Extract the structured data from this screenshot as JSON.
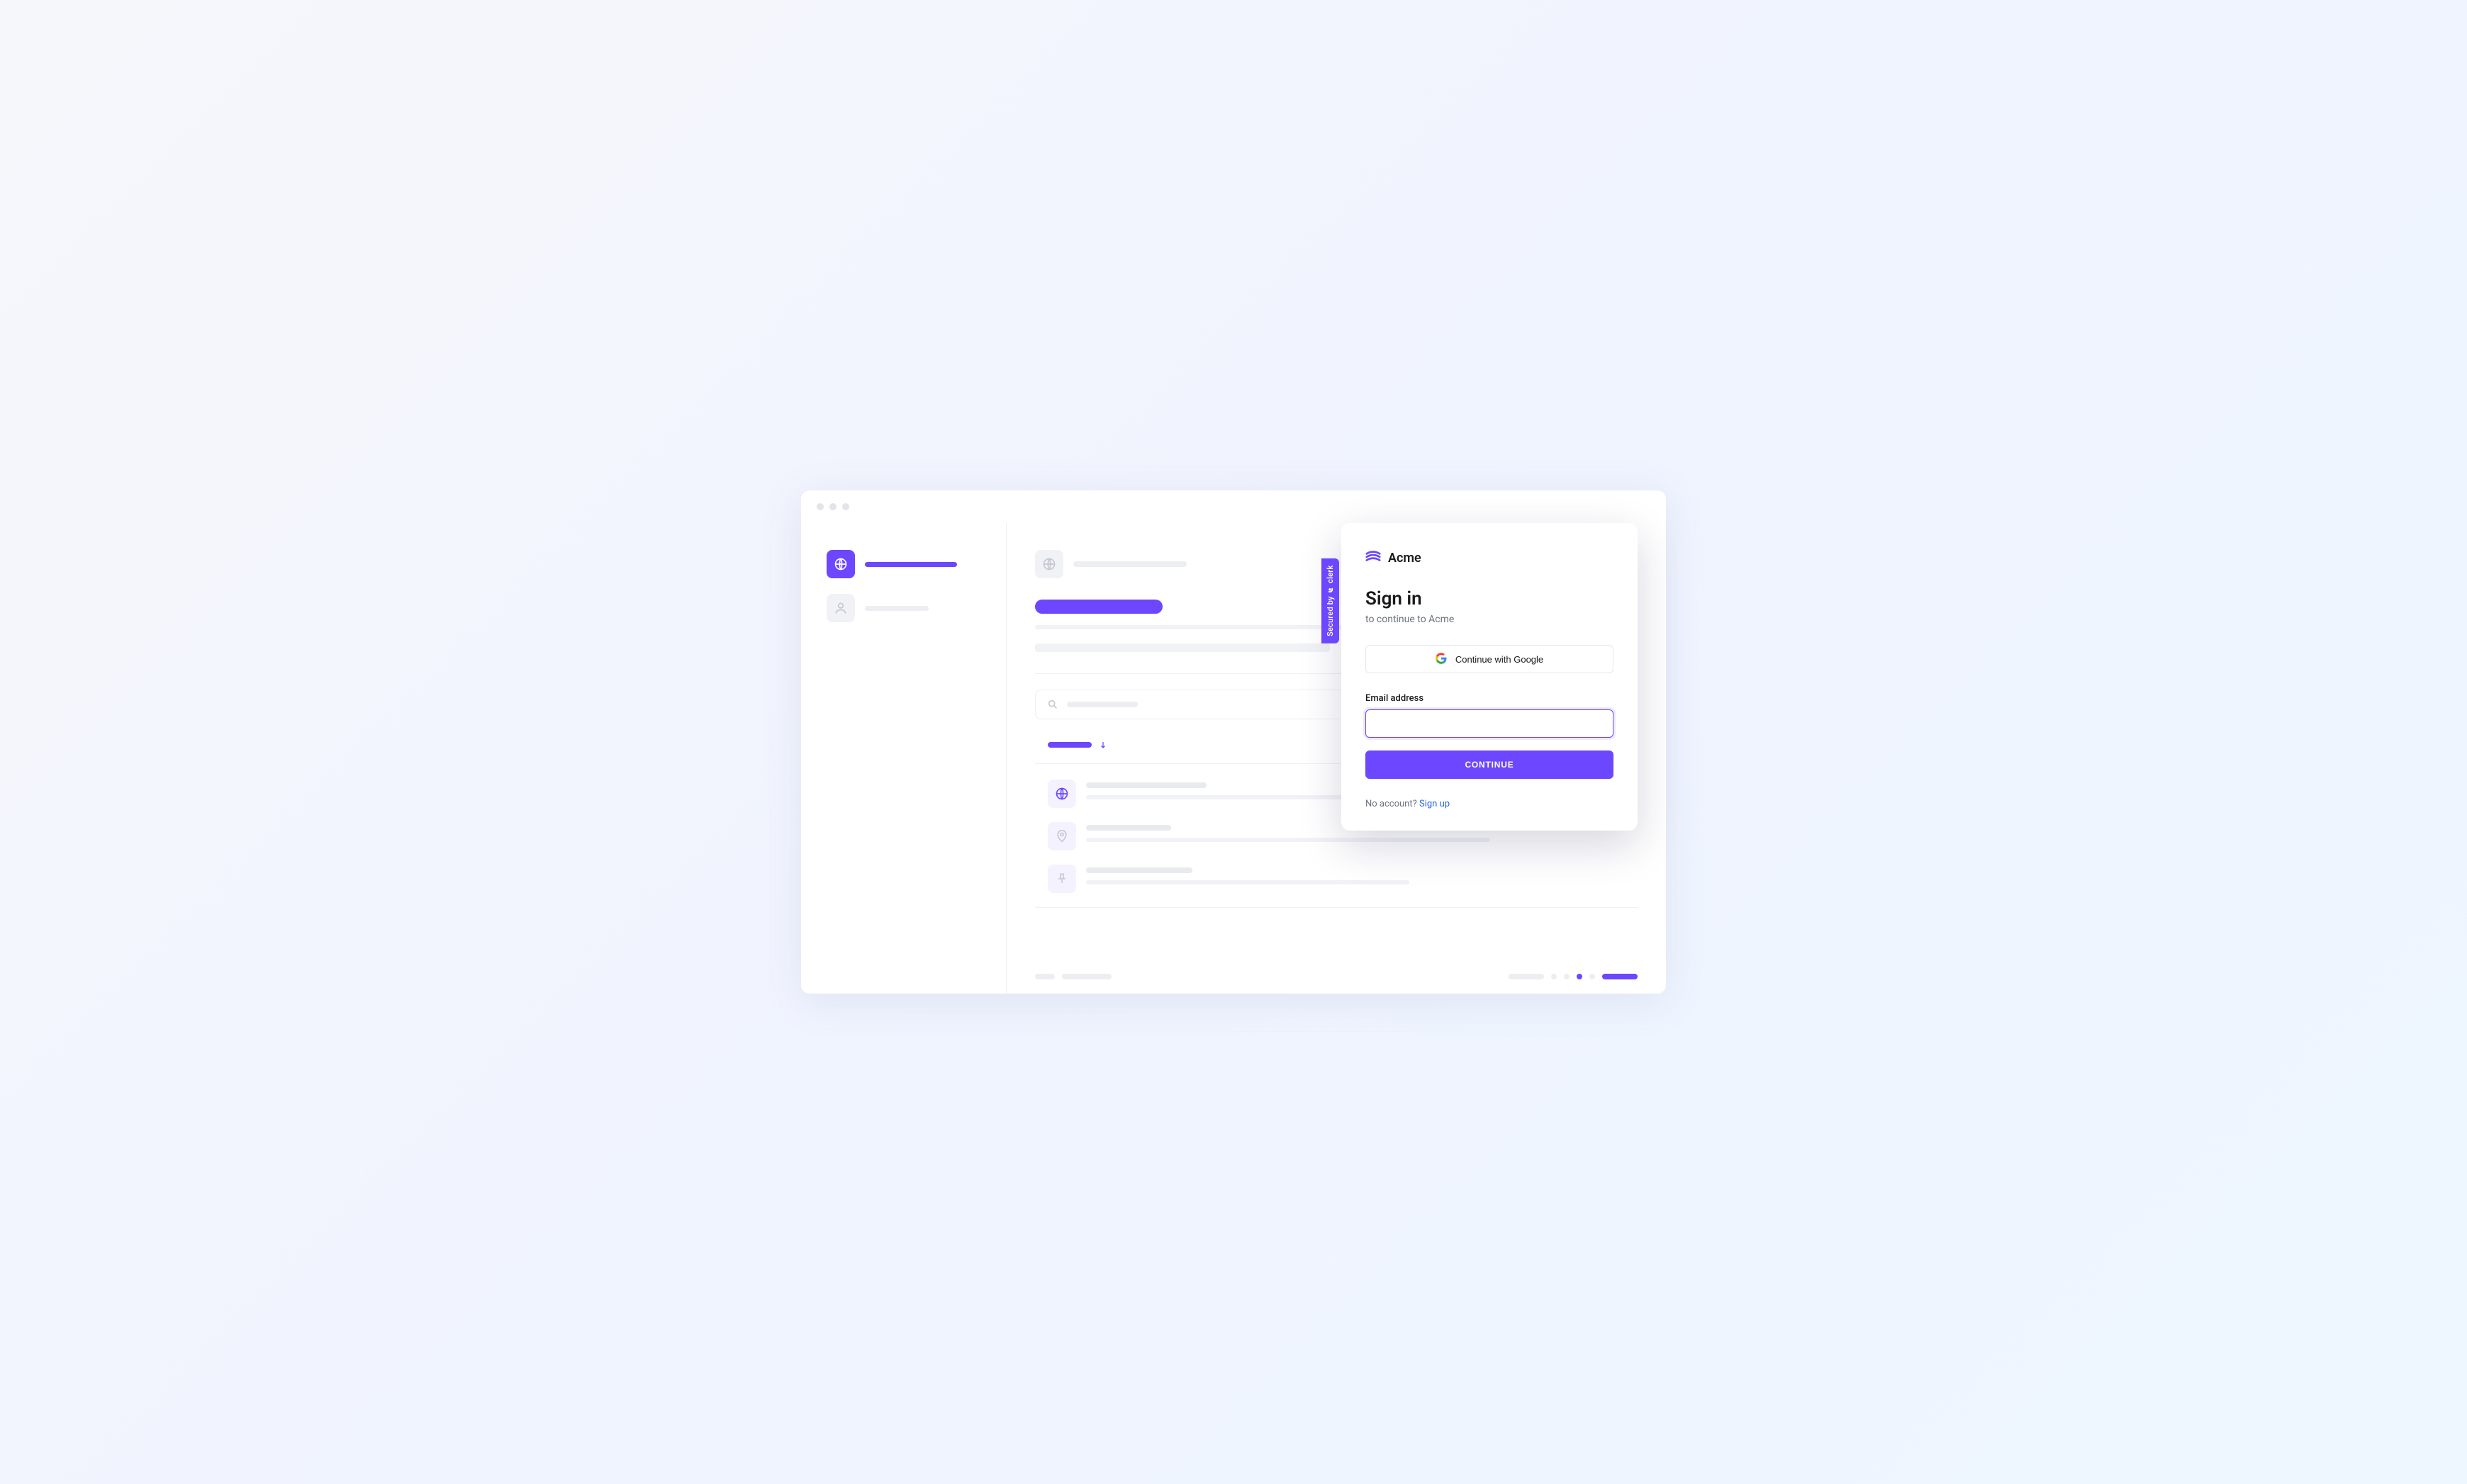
{
  "secured_by": "Secured by",
  "secured_brand": "clerk",
  "brand": "Acme",
  "signin": {
    "title": "Sign in",
    "subtitle": "to continue to Acme",
    "google_label": "Continue with Google",
    "email_label": "Email address",
    "continue_label": "CONTINUE",
    "no_account": "No account? ",
    "signup_link": "Sign up"
  },
  "colors": {
    "accent": "#6c47ff",
    "link": "#2563eb"
  }
}
